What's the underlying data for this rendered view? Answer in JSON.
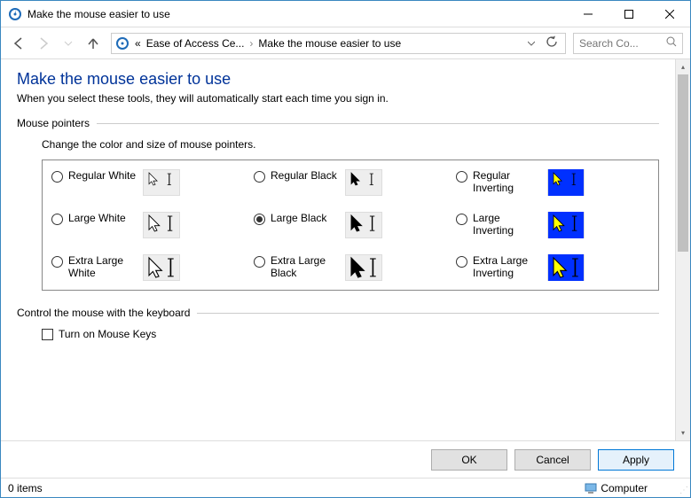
{
  "window": {
    "title": "Make the mouse easier to use"
  },
  "toolbar": {
    "breadcrumb": {
      "prefix": "«",
      "item1": "Ease of Access Ce...",
      "item2": "Make the mouse easier to use"
    },
    "search_placeholder": "Search Co..."
  },
  "page": {
    "heading": "Make the mouse easier to use",
    "subtext": "When you select these tools, they will automatically start each time you sign in."
  },
  "pointers": {
    "section_label": "Mouse pointers",
    "description": "Change the color and size of mouse pointers.",
    "options": [
      {
        "id": "regular-white",
        "label": "Regular White",
        "checked": false,
        "style": "white",
        "size": "s"
      },
      {
        "id": "regular-black",
        "label": "Regular Black",
        "checked": false,
        "style": "black",
        "size": "s"
      },
      {
        "id": "regular-inverting",
        "label": "Regular Inverting",
        "checked": false,
        "style": "inv",
        "size": "s"
      },
      {
        "id": "large-white",
        "label": "Large White",
        "checked": false,
        "style": "white",
        "size": "m"
      },
      {
        "id": "large-black",
        "label": "Large Black",
        "checked": true,
        "style": "black",
        "size": "m"
      },
      {
        "id": "large-inverting",
        "label": "Large Inverting",
        "checked": false,
        "style": "inv",
        "size": "m"
      },
      {
        "id": "extra-large-white",
        "label": "Extra Large White",
        "checked": false,
        "style": "white",
        "size": "l"
      },
      {
        "id": "extra-large-black",
        "label": "Extra Large Black",
        "checked": false,
        "style": "black",
        "size": "l"
      },
      {
        "id": "extra-large-inverting",
        "label": "Extra Large Inverting",
        "checked": false,
        "style": "inv",
        "size": "l"
      }
    ]
  },
  "keyboard": {
    "section_label": "Control the mouse with the keyboard",
    "mousekeys_label": "Turn on Mouse Keys",
    "mousekeys_checked": false
  },
  "buttons": {
    "ok": "OK",
    "cancel": "Cancel",
    "apply": "Apply"
  },
  "status": {
    "items": "0 items",
    "location": "Computer"
  }
}
